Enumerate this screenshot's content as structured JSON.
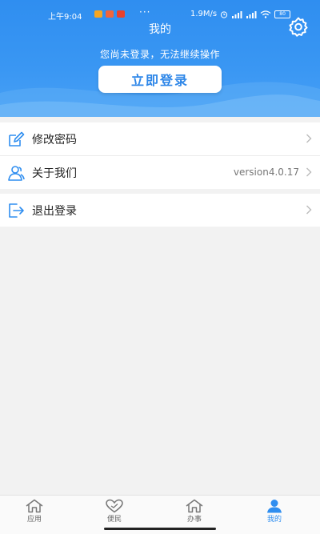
{
  "status_bar": {
    "time": "上午9:04",
    "dots": "···",
    "speed": "1.9M/s",
    "battery": "80"
  },
  "header": {
    "title": "我的",
    "subtitle": "您尚未登录，无法继续操作",
    "login_button": "立即登录",
    "accent_color": "#2f8ef0"
  },
  "menu": {
    "change_password": {
      "label": "修改密码",
      "icon": "edit-icon"
    },
    "about": {
      "label": "关于我们",
      "value": "version4.0.17",
      "icon": "users-icon"
    },
    "logout": {
      "label": "退出登录",
      "icon": "logout-icon"
    }
  },
  "tabbar": {
    "tabs": [
      {
        "label": "应用",
        "icon": "house-icon"
      },
      {
        "label": "便民",
        "icon": "heart-icon"
      },
      {
        "label": "办事",
        "icon": "house-icon"
      },
      {
        "label": "我的",
        "icon": "person-icon",
        "active": true
      }
    ]
  }
}
